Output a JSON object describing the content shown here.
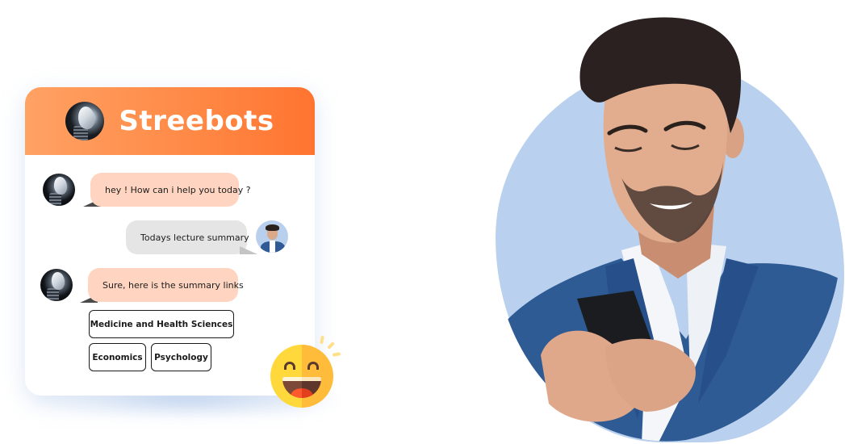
{
  "chat_widget": {
    "title": "Streebots",
    "header_avatar_icon": "robot-avatar-icon",
    "colors": {
      "header_gradient_start": "#ffa264",
      "header_gradient_end": "#ff7430",
      "bot_bubble": "#ffd5c1",
      "user_bubble": "#e5e5e5",
      "link_border": "#1b1b1b"
    },
    "messages": [
      {
        "sender": "bot",
        "text": "hey ! How can i help you today ?"
      },
      {
        "sender": "user",
        "text": "Todays lecture summary"
      },
      {
        "sender": "bot",
        "text": "Sure, here is the summary links"
      }
    ],
    "links": [
      {
        "label": "Medicine and Health Sciences"
      },
      {
        "label": "Economics"
      },
      {
        "label": "Psychology"
      }
    ]
  },
  "decorations": {
    "emoji": "laughing-face-emoji-icon",
    "hero_image": "smiling man in blue suit looking at smartphone"
  }
}
